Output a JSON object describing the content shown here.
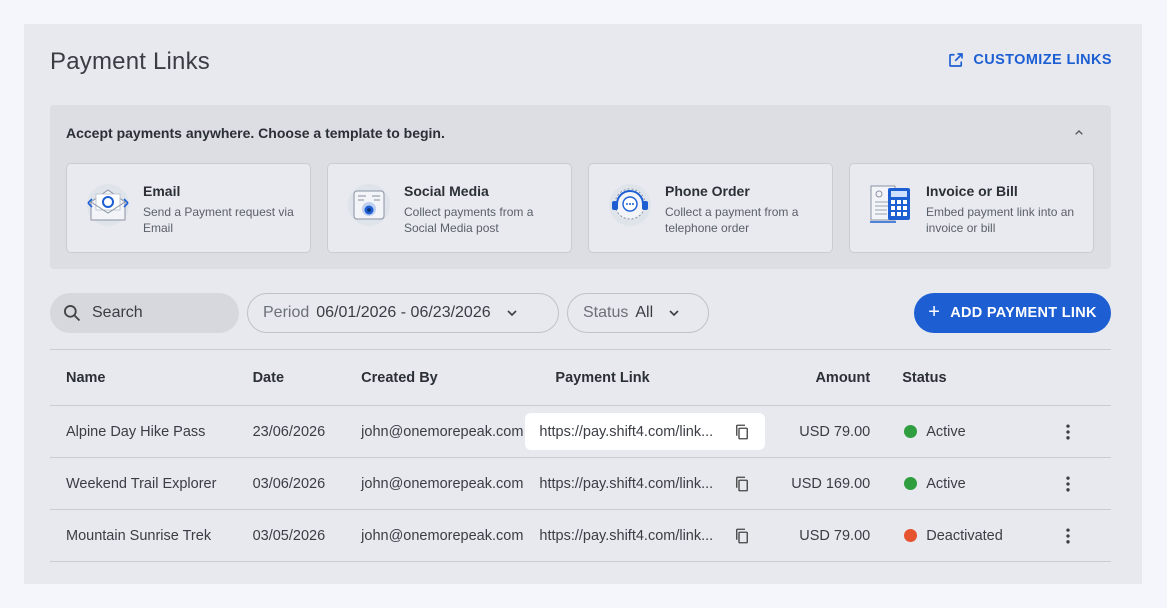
{
  "header": {
    "title": "Payment Links",
    "customize_label": "CUSTOMIZE LINKS",
    "customize_icon": "open-in-new-icon"
  },
  "banner": {
    "title": "Accept payments anywhere. Choose a template to begin.",
    "cards": [
      {
        "title": "Email",
        "description": "Send a Payment request via Email",
        "icon": "email-envelope-icon"
      },
      {
        "title": "Social Media",
        "description": "Collect payments from a Social Media post",
        "icon": "social-media-icon"
      },
      {
        "title": "Phone Order",
        "description": "Collect a payment from a telephone order",
        "icon": "phone-headset-icon"
      },
      {
        "title": "Invoice or Bill",
        "description": "Embed payment link into an invoice or bill",
        "icon": "invoice-calculator-icon"
      }
    ]
  },
  "toolbar": {
    "search_placeholder": "Search",
    "period_label": "Period",
    "period_value": "06/01/2026 - 06/23/2026",
    "status_label": "Status",
    "status_value": "All",
    "add_label": "ADD PAYMENT LINK"
  },
  "table": {
    "columns": [
      "Name",
      "Date",
      "Created By",
      "Payment Link",
      "Amount",
      "Status"
    ],
    "rows": [
      {
        "name": "Alpine Day Hike Pass",
        "date": "23/06/2026",
        "created_by": "john@onemorepeak.com",
        "link": "https://pay.shift4.com/link...",
        "amount": "USD 79.00",
        "status": "Active",
        "status_color": "#2e9e3e"
      },
      {
        "name": "Weekend Trail Explorer",
        "date": "03/06/2026",
        "created_by": "john@onemorepeak.com",
        "link": "https://pay.shift4.com/link...",
        "amount": "USD 169.00",
        "status": "Active",
        "status_color": "#2e9e3e"
      },
      {
        "name": "Mountain Sunrise Trek",
        "date": "03/05/2026",
        "created_by": "john@onemorepeak.com",
        "link": "https://pay.shift4.com/link...",
        "amount": "USD 79.00",
        "status": "Deactivated",
        "status_color": "#e5532f"
      }
    ]
  },
  "colors": {
    "accent": "#1d5fd3",
    "active": "#2e9e3e",
    "deactivated": "#e5532f"
  }
}
